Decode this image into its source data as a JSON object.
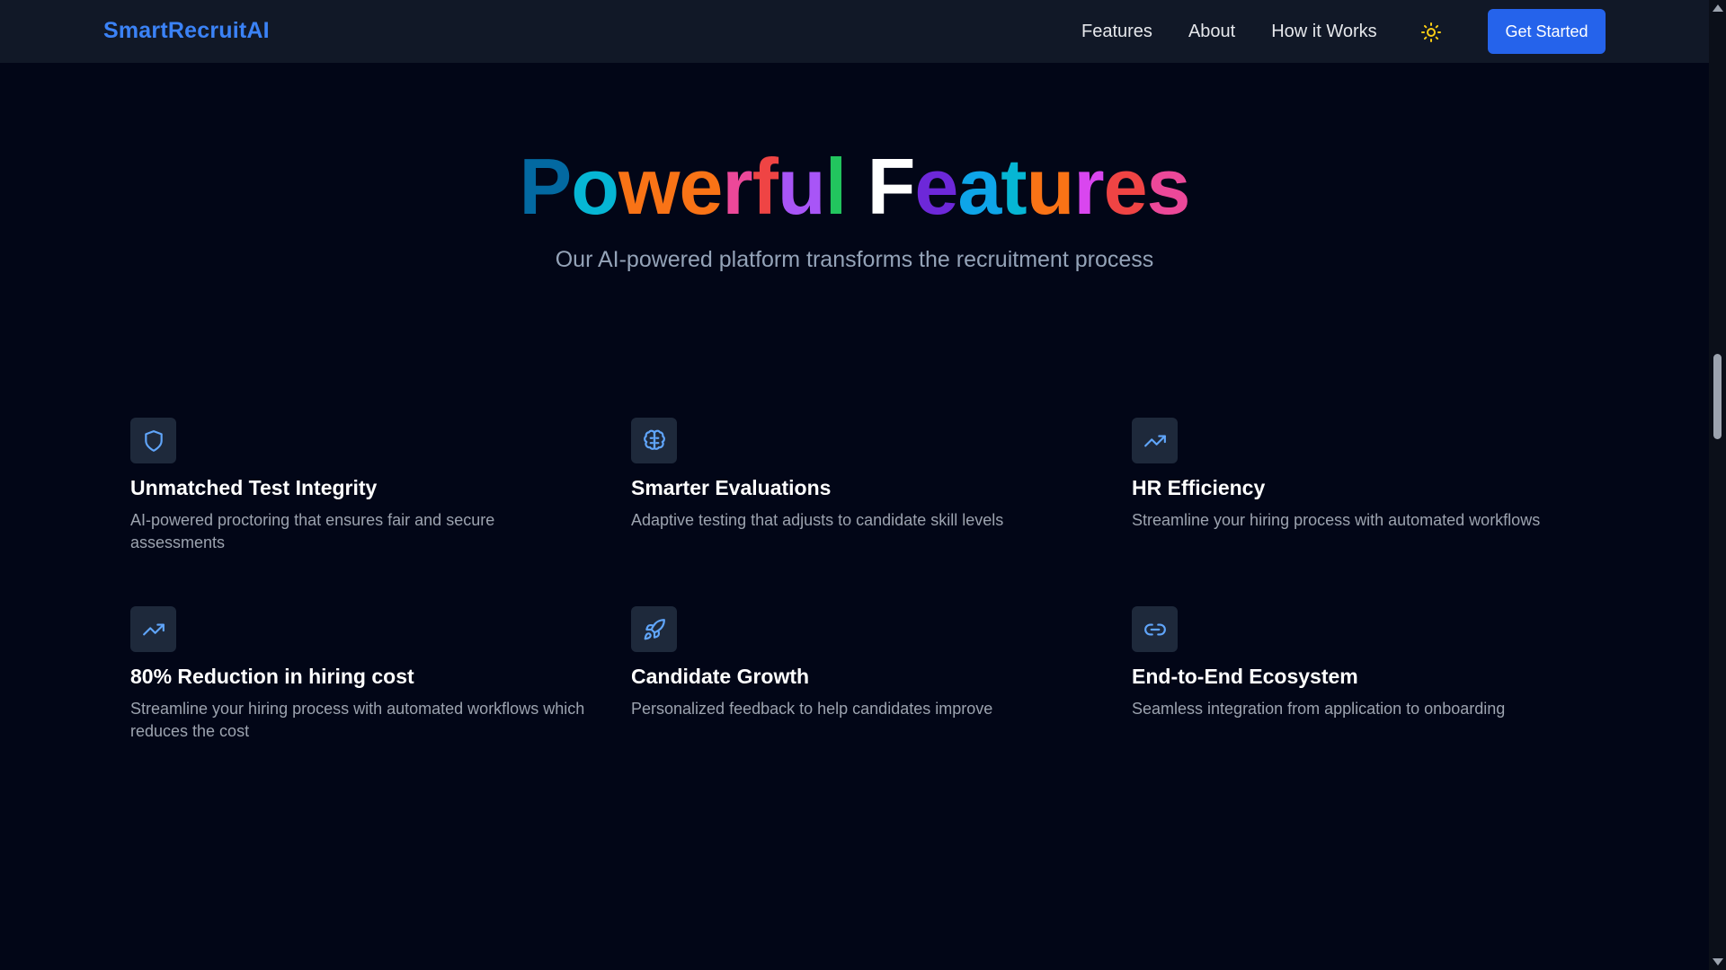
{
  "nav": {
    "brand": "SmartRecruitAI",
    "links": [
      "Features",
      "About",
      "How it Works"
    ],
    "theme_icon": "sun-icon",
    "cta_label": "Get Started"
  },
  "hero": {
    "title": "Powerful Features",
    "subtitle": "Our AI-powered platform transforms the recruitment process",
    "title_colors": [
      "#0369a1",
      "#06b6d4",
      "#f97316",
      "#f97316",
      "#ec4899",
      "#ef4444",
      "#a855f7",
      "#22c55e",
      "#ef4444",
      "#ffffff",
      "#6d28d9",
      "#0ea5e9",
      "#06b6d4",
      "#f97316",
      "#d946ef",
      "#ef4444",
      "#ec4899",
      "#22c55e"
    ]
  },
  "features": [
    {
      "icon": "shield-icon",
      "title": "Unmatched Test Integrity",
      "desc": "AI-powered proctoring that ensures fair and secure assessments"
    },
    {
      "icon": "brain-icon",
      "title": "Smarter Evaluations",
      "desc": "Adaptive testing that adjusts to candidate skill levels"
    },
    {
      "icon": "trending-up-icon",
      "title": "HR Efficiency",
      "desc": "Streamline your hiring process with automated workflows"
    },
    {
      "icon": "trending-up-icon",
      "title": "80% Reduction in hiring cost",
      "desc": "Streamline your hiring process with automated workflows which reduces the cost"
    },
    {
      "icon": "rocket-icon",
      "title": "Candidate Growth",
      "desc": "Personalized feedback to help candidates improve"
    },
    {
      "icon": "link-icon",
      "title": "End-to-End Ecosystem",
      "desc": "Seamless integration from application to onboarding"
    }
  ],
  "colors": {
    "accent": "#2563eb",
    "brand": "#3b82f6",
    "icon": "#60a5fa",
    "sun": "#facc15",
    "background": "#020617",
    "navbar": "#111827"
  }
}
